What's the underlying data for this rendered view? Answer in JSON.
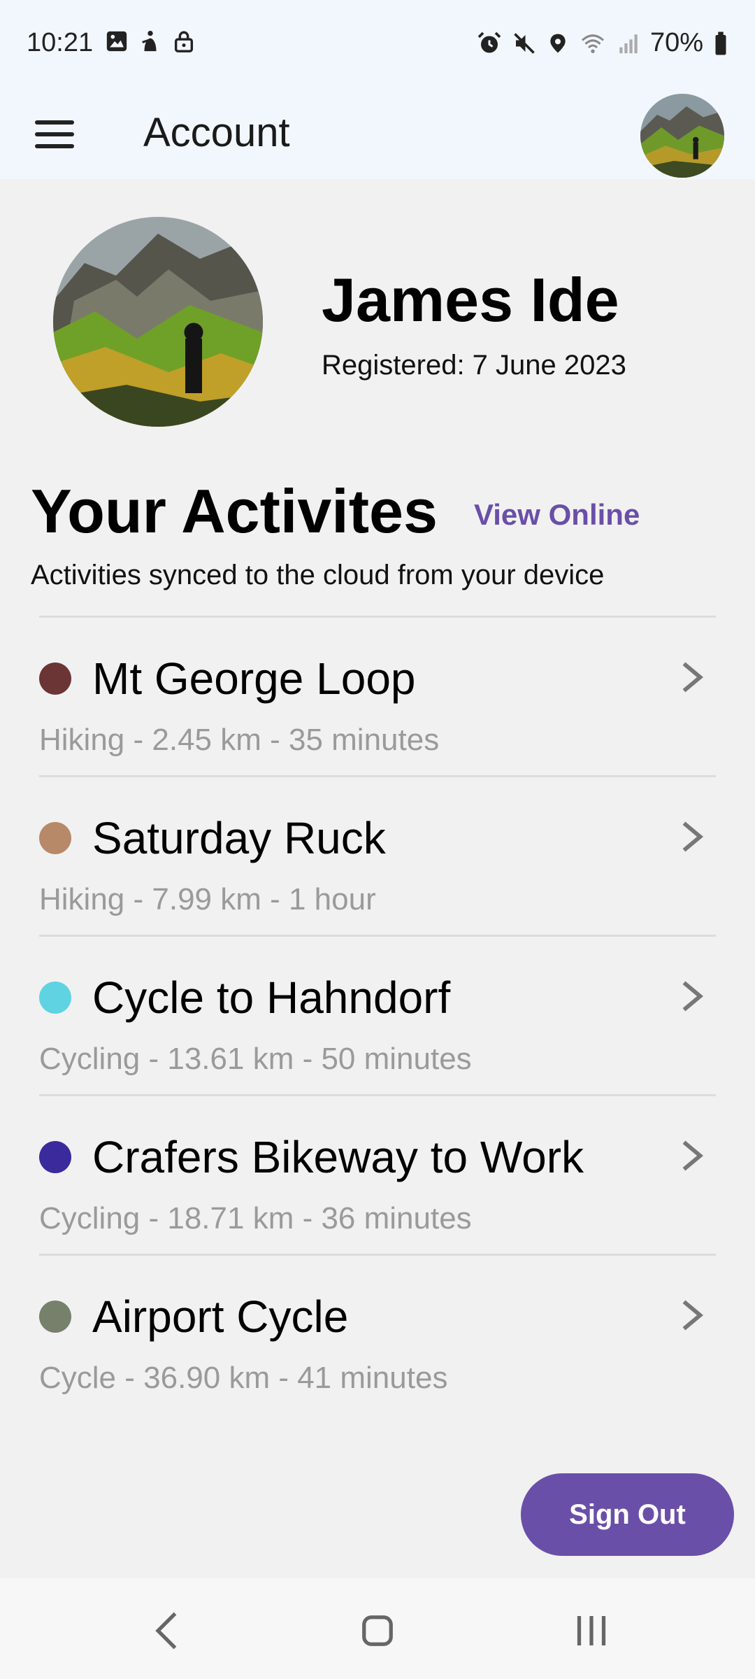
{
  "status_bar": {
    "time": "10:21",
    "battery": "70%",
    "left_icons": [
      "gallery-icon",
      "accessibility-icon",
      "lock-icon"
    ],
    "right_icons": [
      "alarm-icon",
      "mute-icon",
      "location-icon",
      "wifi-icon",
      "signal-icon",
      "battery-icon"
    ]
  },
  "app_bar": {
    "title": "Account"
  },
  "profile": {
    "name": "James Ide",
    "registered": "Registered: 7 June 2023"
  },
  "activities_section": {
    "title": "Your Activites",
    "view_online_label": "View Online",
    "subtitle": "Activities synced to the cloud from your device"
  },
  "activities": [
    {
      "title": "Mt George Loop",
      "meta": "Hiking - 2.45 km - 35 minutes",
      "color": "#6b3535"
    },
    {
      "title": "Saturday Ruck",
      "meta": "Hiking - 7.99 km - 1 hour",
      "color": "#b88968"
    },
    {
      "title": "Cycle to Hahndorf",
      "meta": "Cycling - 13.61 km - 50 minutes",
      "color": "#5fd3e2"
    },
    {
      "title": "Crafers Bikeway to Work",
      "meta": "Cycling - 18.71 km - 36 minutes",
      "color": "#3a2a9c"
    },
    {
      "title": "Airport Cycle",
      "meta": "Cycle - 36.90 km - 41 minutes",
      "color": "#76806a"
    }
  ],
  "sign_out_label": "Sign Out",
  "colors": {
    "accent": "#6a4fa8",
    "header_bg": "#f2f7fe",
    "page_bg": "#f1f1f1"
  }
}
